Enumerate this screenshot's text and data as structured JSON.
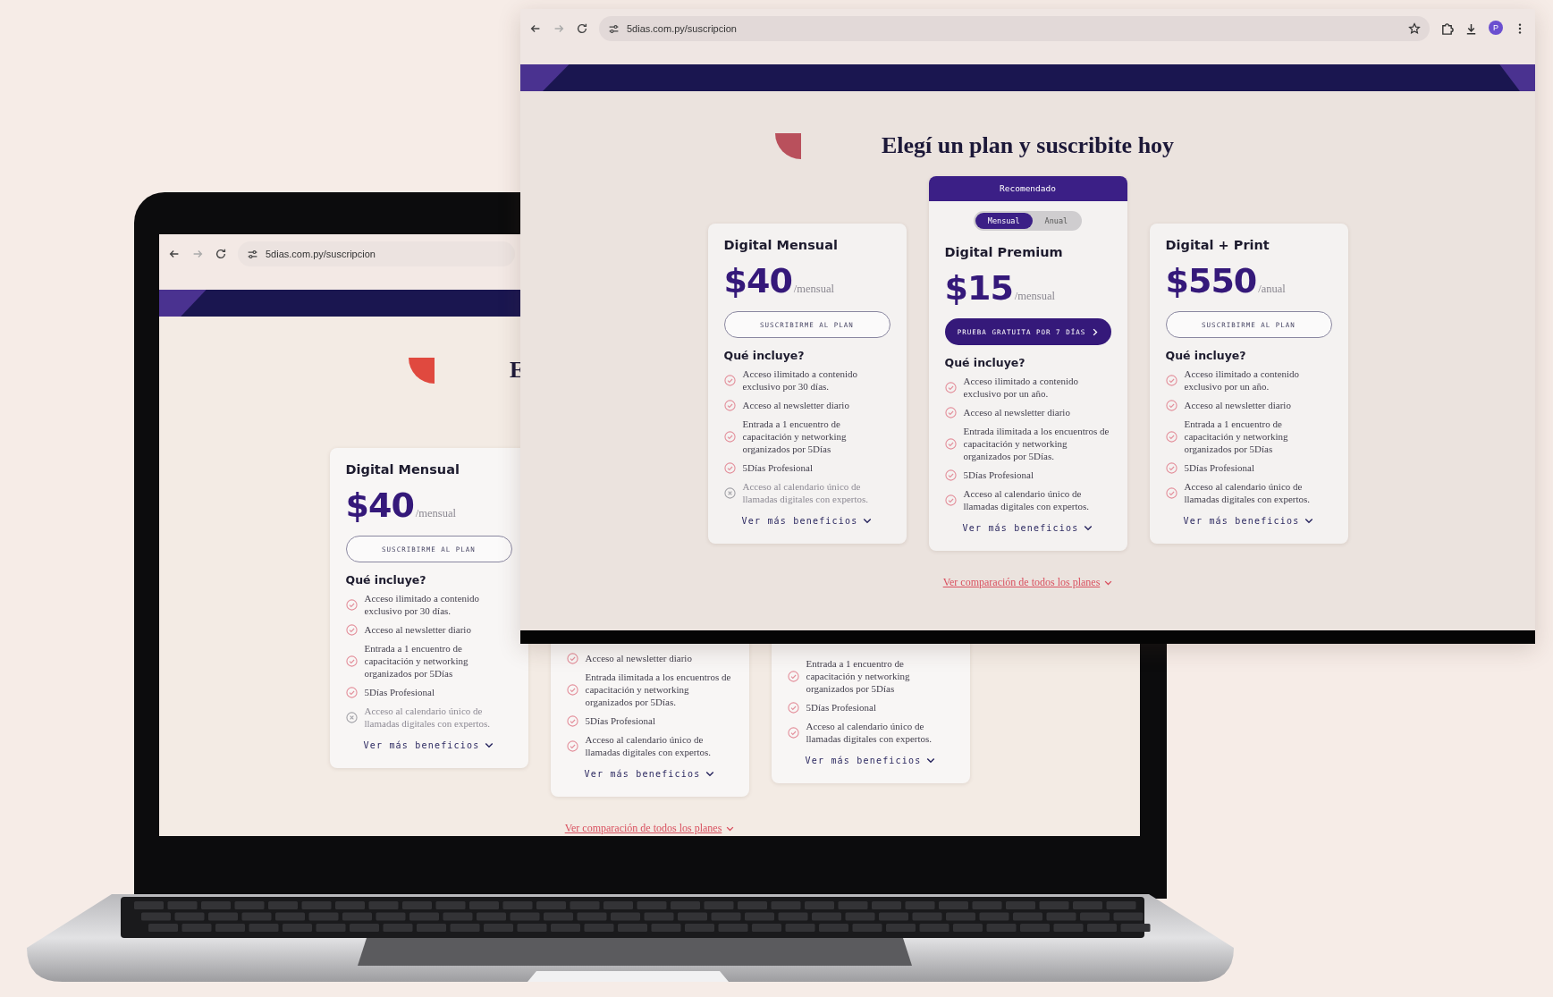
{
  "laptop": {
    "browser": {
      "url": "5dias.com.py/suscripcion"
    },
    "heading": "E",
    "cards": [
      {
        "title": "Digital Mensual",
        "price": "$40",
        "period": "/mensual",
        "button": {
          "kind": "outline",
          "label": "SUSCRIBIRME AL PLAN"
        },
        "includes_title": "Qué incluye?",
        "features": [
          {
            "text": "Acceso ilimitado a contenido exclusivo por 30 días.",
            "included": true
          },
          {
            "text": "Acceso al newsletter diario",
            "included": true
          },
          {
            "text": "Entrada a 1 encuentro de capacitación y networking organizados por 5Días",
            "included": true
          },
          {
            "text": "5Días Profesional",
            "included": true
          },
          {
            "text": "Acceso al calendario único de llamadas digitales con expertos.",
            "included": false
          }
        ],
        "more": "Ver más beneficios"
      },
      {
        "features": [
          {
            "text": "Acceso al newsletter diario",
            "included": true
          },
          {
            "text": "Entrada ilimitada a los encuentros de capacitación y networking organizados por 5Días.",
            "included": true
          },
          {
            "text": "5Días Profesional",
            "included": true
          },
          {
            "text": "Acceso al calendario único de llamadas digitales con expertos.",
            "included": true
          }
        ],
        "more": "Ver más beneficios"
      },
      {
        "features": [
          {
            "text": "Entrada a 1 encuentro de capacitación y networking organizados por 5Días",
            "included": true
          },
          {
            "text": "5Días Profesional",
            "included": true
          },
          {
            "text": "Acceso al calendario único de llamadas digitales con expertos.",
            "included": true
          }
        ],
        "more": "Ver más beneficios"
      }
    ],
    "compare_link": "Ver comparación de todos los planes"
  },
  "window": {
    "browser": {
      "url": "5dias.com.py/suscripcion",
      "avatar": "P"
    },
    "heading": "Elegí un plan y suscribite hoy",
    "cards": [
      {
        "title": "Digital Mensual",
        "price": "$40",
        "period": "/mensual",
        "button": {
          "kind": "outline",
          "label": "SUSCRIBIRME AL PLAN"
        },
        "includes_title": "Qué incluye?",
        "features": [
          {
            "text": "Acceso ilimitado a contenido exclusivo por 30 días.",
            "included": true
          },
          {
            "text": "Acceso al newsletter diario",
            "included": true
          },
          {
            "text": "Entrada a 1 encuentro de capacitación y networking organizados por 5Días",
            "included": true
          },
          {
            "text": "5Días Profesional",
            "included": true
          },
          {
            "text": "Acceso al calendario único de llamadas digitales con expertos.",
            "included": false
          }
        ],
        "more": "Ver más beneficios"
      },
      {
        "badge": "Recomendado",
        "toggle": [
          {
            "label": "Mensual",
            "selected": true
          },
          {
            "label": "Anual",
            "selected": false
          }
        ],
        "title": "Digital Premium",
        "price": "$15",
        "period": "/mensual",
        "button": {
          "kind": "primary",
          "label": "PRUEBA GRATUITA POR 7 DÍAS"
        },
        "includes_title": "Qué incluye?",
        "features": [
          {
            "text": "Acceso ilimitado a contenido exclusivo por un año.",
            "included": true
          },
          {
            "text": "Acceso al newsletter diario",
            "included": true
          },
          {
            "text": "Entrada ilimitada a los encuentros de capacitación y networking organizados por 5Días.",
            "included": true
          },
          {
            "text": "5Días Profesional",
            "included": true
          },
          {
            "text": "Acceso al calendario único de llamadas digitales con expertos.",
            "included": true
          }
        ],
        "more": "Ver más beneficios"
      },
      {
        "title": "Digital + Print",
        "price": "$550",
        "period": "/anual",
        "button": {
          "kind": "outline",
          "label": "SUSCRIBIRME AL PLAN"
        },
        "includes_title": "Qué incluye?",
        "features": [
          {
            "text": "Acceso ilimitado a contenido exclusivo por un año.",
            "included": true
          },
          {
            "text": "Acceso al newsletter diario",
            "included": true
          },
          {
            "text": "Entrada a 1 encuentro de capacitación y networking organizados por 5Días",
            "included": true
          },
          {
            "text": "5Días Profesional",
            "included": true
          },
          {
            "text": "Acceso al calendario único de llamadas digitales con expertos.",
            "included": true
          }
        ],
        "more": "Ver más beneficios"
      }
    ],
    "compare_link": "Ver comparación de todos los planes"
  }
}
